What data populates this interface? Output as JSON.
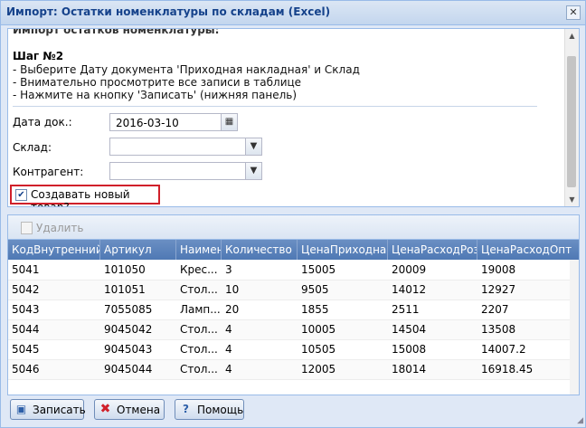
{
  "window": {
    "title": "Импорт: Остатки номенклатуры по складам (Excel)",
    "close_glyph": "✕"
  },
  "instructions": {
    "cut_header": "Импорт остатков номенклатуры:",
    "step_title": "Шаг №2",
    "lines": [
      "- Выберите Дату документа 'Приходная накладная' и Склад",
      "- Внимательно просмотрите все записи в таблице",
      "- Нажмите на кнопку 'Записать' (нижняя панель)"
    ]
  },
  "form": {
    "date_label": "Дата док.:",
    "date_value": "2016-03-10",
    "warehouse_label": "Склад:",
    "warehouse_value": "",
    "contractor_label": "Контрагент:",
    "contractor_value": "",
    "create_new_label": "Создавать новый товар?",
    "create_new_checked": true
  },
  "grid": {
    "delete_label": "Удалить",
    "columns": [
      "КодВнутренний",
      "Артикул",
      "Наименование",
      "Количество",
      "ЦенаПриходная",
      "ЦенаРасходРозница",
      "ЦенаРасходОпт"
    ],
    "rows": [
      [
        "5041",
        "101050",
        "Крес...",
        "3",
        "15005",
        "20009",
        "19008"
      ],
      [
        "5042",
        "101051",
        "Стол...",
        "10",
        "9505",
        "14012",
        "12927"
      ],
      [
        "5043",
        "7055085",
        "Ламп...",
        "20",
        "1855",
        "2511",
        "2207"
      ],
      [
        "5044",
        "9045042",
        "Стол...",
        "4",
        "10005",
        "14504",
        "13508"
      ],
      [
        "5045",
        "9045043",
        "Стол...",
        "4",
        "10505",
        "15008",
        "14007.2"
      ],
      [
        "5046",
        "9045044",
        "Стол...",
        "4",
        "12005",
        "18014",
        "16918.45"
      ]
    ]
  },
  "buttons": {
    "save": "Записать",
    "cancel": "Отмена",
    "help": "Помощь"
  },
  "colors": {
    "highlight_border": "#d0202a",
    "header_blue": "#4f79b4"
  }
}
